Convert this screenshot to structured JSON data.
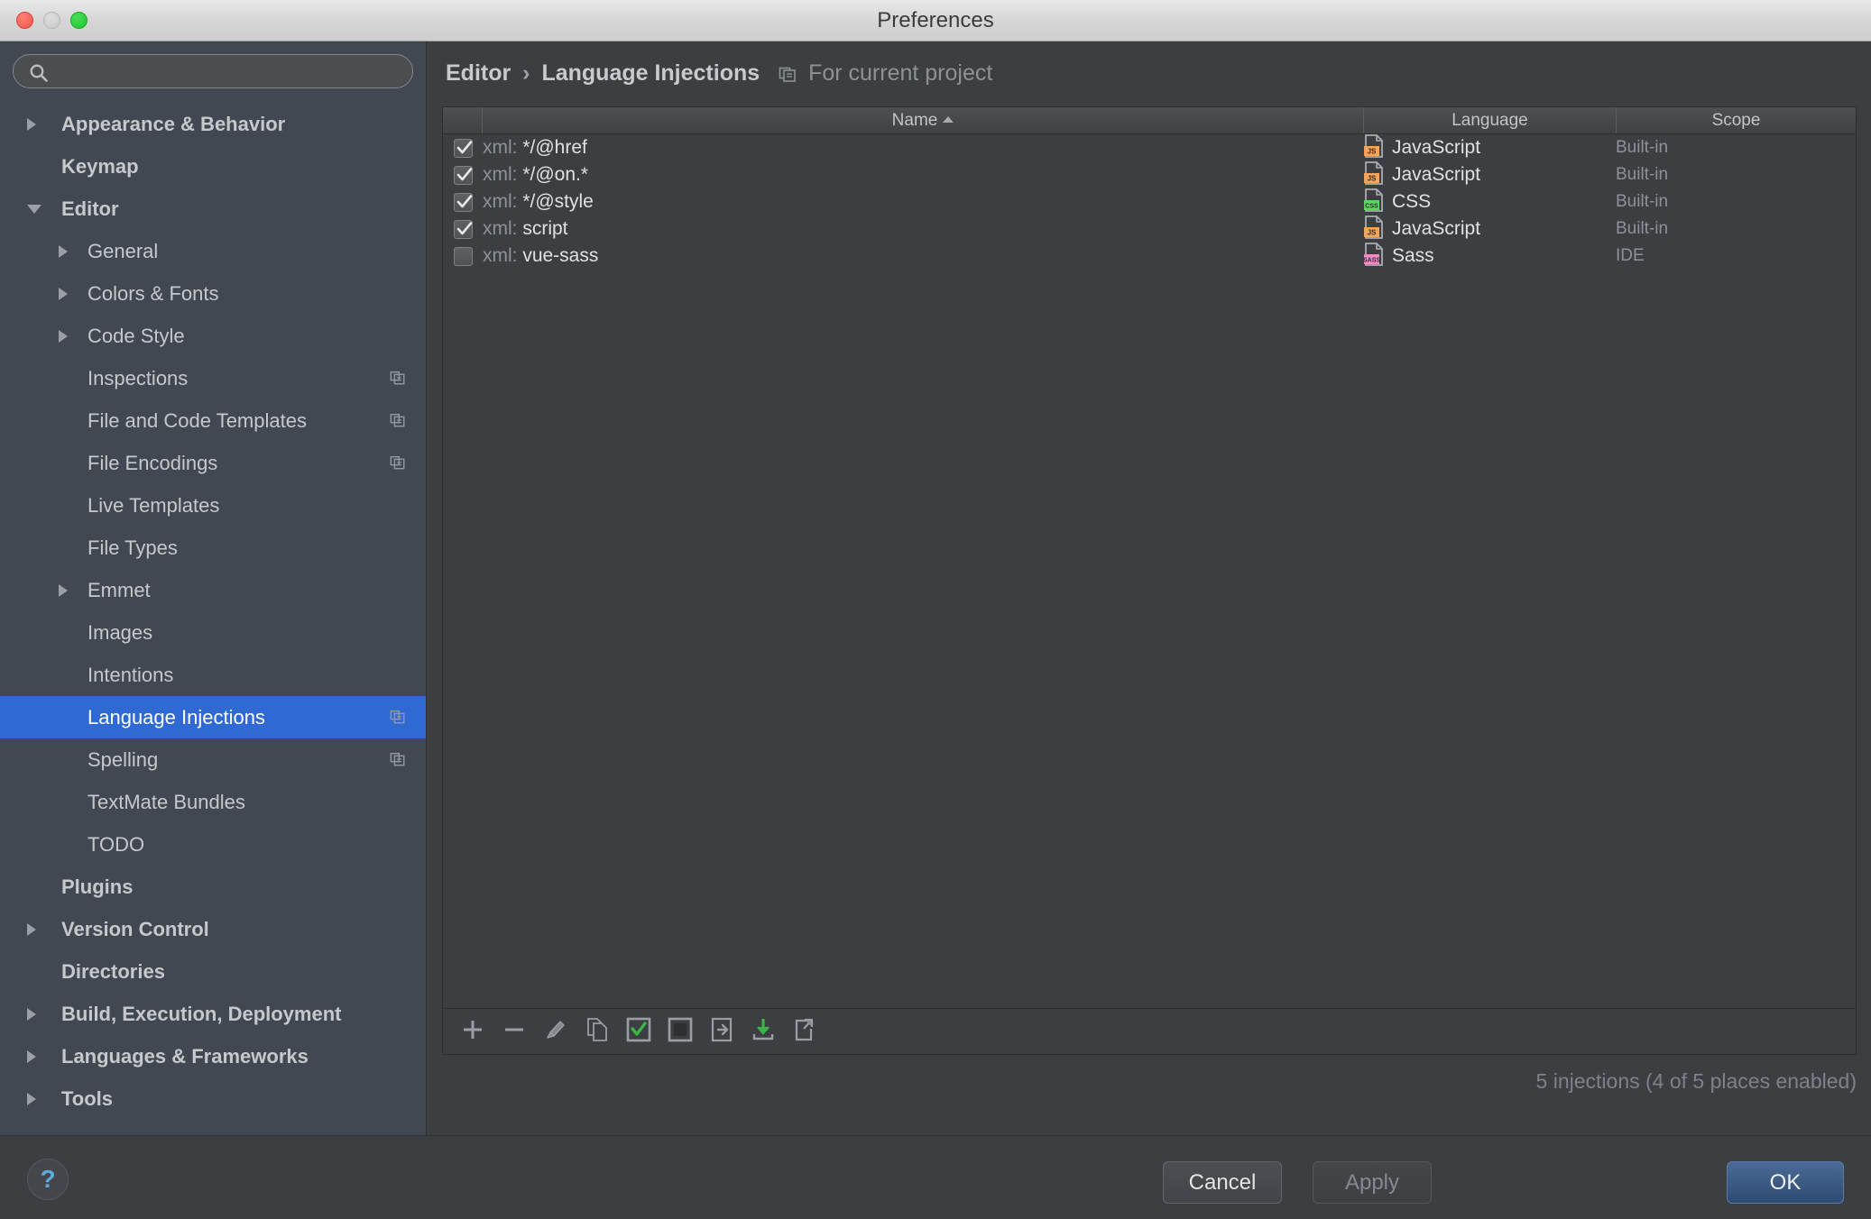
{
  "window": {
    "title": "Preferences",
    "traffic_lights": [
      "close",
      "minimize",
      "zoom"
    ]
  },
  "sidebar": {
    "search": {
      "value": "",
      "placeholder": ""
    },
    "items": [
      {
        "label": "Appearance & Behavior",
        "level": 0,
        "arrow": "collapsed",
        "selected": false,
        "project_icon": false
      },
      {
        "label": "Keymap",
        "level": 0,
        "arrow": "none",
        "selected": false,
        "project_icon": false
      },
      {
        "label": "Editor",
        "level": 0,
        "arrow": "expanded",
        "selected": false,
        "project_icon": false
      },
      {
        "label": "General",
        "level": 1,
        "arrow": "collapsed",
        "selected": false,
        "project_icon": false
      },
      {
        "label": "Colors & Fonts",
        "level": 1,
        "arrow": "collapsed",
        "selected": false,
        "project_icon": false
      },
      {
        "label": "Code Style",
        "level": 1,
        "arrow": "collapsed",
        "selected": false,
        "project_icon": false
      },
      {
        "label": "Inspections",
        "level": 1,
        "arrow": "none",
        "selected": false,
        "project_icon": true
      },
      {
        "label": "File and Code Templates",
        "level": 1,
        "arrow": "none",
        "selected": false,
        "project_icon": true
      },
      {
        "label": "File Encodings",
        "level": 1,
        "arrow": "none",
        "selected": false,
        "project_icon": true
      },
      {
        "label": "Live Templates",
        "level": 1,
        "arrow": "none",
        "selected": false,
        "project_icon": false
      },
      {
        "label": "File Types",
        "level": 1,
        "arrow": "none",
        "selected": false,
        "project_icon": false
      },
      {
        "label": "Emmet",
        "level": 1,
        "arrow": "collapsed",
        "selected": false,
        "project_icon": false
      },
      {
        "label": "Images",
        "level": 1,
        "arrow": "none",
        "selected": false,
        "project_icon": false
      },
      {
        "label": "Intentions",
        "level": 1,
        "arrow": "none",
        "selected": false,
        "project_icon": false
      },
      {
        "label": "Language Injections",
        "level": 1,
        "arrow": "none",
        "selected": true,
        "project_icon": true
      },
      {
        "label": "Spelling",
        "level": 1,
        "arrow": "none",
        "selected": false,
        "project_icon": true
      },
      {
        "label": "TextMate Bundles",
        "level": 1,
        "arrow": "none",
        "selected": false,
        "project_icon": false
      },
      {
        "label": "TODO",
        "level": 1,
        "arrow": "none",
        "selected": false,
        "project_icon": false
      },
      {
        "label": "Plugins",
        "level": 0,
        "arrow": "none",
        "selected": false,
        "project_icon": false
      },
      {
        "label": "Version Control",
        "level": 0,
        "arrow": "collapsed",
        "selected": false,
        "project_icon": false
      },
      {
        "label": "Directories",
        "level": 0,
        "arrow": "none",
        "selected": false,
        "project_icon": false
      },
      {
        "label": "Build, Execution, Deployment",
        "level": 0,
        "arrow": "collapsed",
        "selected": false,
        "project_icon": false
      },
      {
        "label": "Languages & Frameworks",
        "level": 0,
        "arrow": "collapsed",
        "selected": false,
        "project_icon": false
      },
      {
        "label": "Tools",
        "level": 0,
        "arrow": "collapsed",
        "selected": false,
        "project_icon": false
      }
    ]
  },
  "breadcrumb": {
    "root": "Editor",
    "separator": "›",
    "current": "Language Injections",
    "scope_note": "For current project"
  },
  "table": {
    "columns": [
      {
        "label": "",
        "key": "checkbox"
      },
      {
        "label": "Name",
        "key": "name",
        "sort": "asc"
      },
      {
        "label": "Language",
        "key": "language"
      },
      {
        "label": "Scope",
        "key": "scope"
      }
    ],
    "rows": [
      {
        "enabled": true,
        "name_prefix": "xml: ",
        "name": "*/@href",
        "language": "JavaScript",
        "lang_badge": "JS",
        "scope": "Built-in"
      },
      {
        "enabled": true,
        "name_prefix": "xml: ",
        "name": "*/@on.*",
        "language": "JavaScript",
        "lang_badge": "JS",
        "scope": "Built-in"
      },
      {
        "enabled": true,
        "name_prefix": "xml: ",
        "name": "*/@style",
        "language": "CSS",
        "lang_badge": "CSS",
        "scope": "Built-in"
      },
      {
        "enabled": true,
        "name_prefix": "xml: ",
        "name": "script",
        "language": "JavaScript",
        "lang_badge": "JS",
        "scope": "Built-in"
      },
      {
        "enabled": false,
        "name_prefix": "xml: ",
        "name": "vue-sass",
        "language": "Sass",
        "lang_badge": "SASS",
        "scope": "IDE"
      }
    ],
    "status": "5 injections (4 of 5 places enabled)"
  },
  "toolbar": {
    "buttons": [
      {
        "name": "add-injection-button",
        "icon": "plus-icon"
      },
      {
        "name": "remove-injection-button",
        "icon": "minus-icon"
      },
      {
        "name": "edit-injection-button",
        "icon": "pencil-icon"
      },
      {
        "name": "duplicate-injection-button",
        "icon": "copy-icon"
      },
      {
        "name": "enable-selected-button",
        "icon": "checked-box-icon"
      },
      {
        "name": "disable-selected-button",
        "icon": "filled-box-icon"
      },
      {
        "name": "import-button",
        "icon": "import-icon"
      },
      {
        "name": "download-button",
        "icon": "download-icon"
      },
      {
        "name": "export-button",
        "icon": "export-icon"
      }
    ]
  },
  "footer": {
    "help": "?",
    "cancel": "Cancel",
    "apply": "Apply",
    "apply_disabled": true,
    "ok": "OK"
  },
  "colors": {
    "window_chrome": "#d5d5d5",
    "sidebar_bg": "#414852",
    "content_bg": "#3c3f41",
    "selection_blue": "#2f69d4",
    "ok_button_blue": "#3a5a86",
    "text_primary": "#c6c9cc",
    "text_dim": "#8e9296",
    "badge_js": "#f5a45c",
    "badge_css": "#5fd35f",
    "badge_sass": "#f28ac8",
    "accent_green": "#3cb44a",
    "help_blue": "#5fa8d8"
  }
}
